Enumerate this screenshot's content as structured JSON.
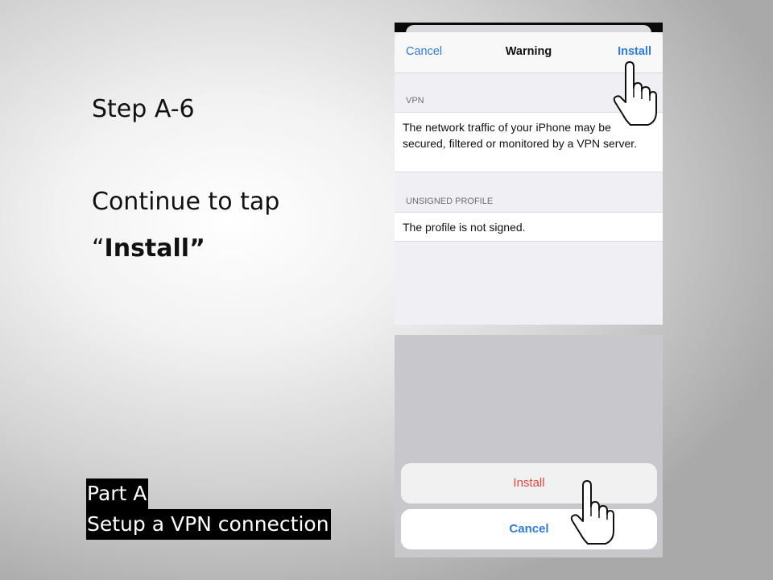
{
  "slide": {
    "step": "Step A-6",
    "instruction": "Continue to tap",
    "quote_open": "“",
    "quote_word": "Install”",
    "part": "Part A",
    "part_desc": "Setup a VPN connection"
  },
  "warning_screen": {
    "cancel": "Cancel",
    "title": "Warning",
    "install": "Install",
    "vpn_header": "VPN",
    "vpn_text": "The network traffic of your iPhone may be secured, filtered or monitored by a VPN server.",
    "unsigned_header": "UNSIGNED PROFILE",
    "unsigned_text": "The profile is not signed."
  },
  "action_sheet": {
    "install": "Install",
    "cancel": "Cancel"
  },
  "icons": [
    "pointing-hand-icon"
  ],
  "colors": {
    "ios_blue": "#2f7bd9",
    "destructive_red": "#e0463b"
  }
}
